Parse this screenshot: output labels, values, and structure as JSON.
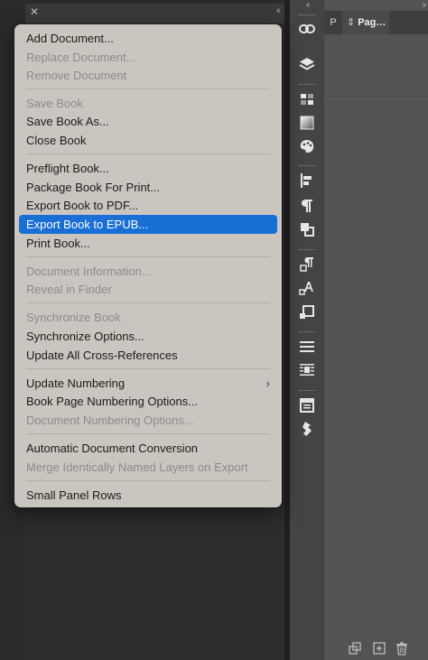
{
  "right_panel": {
    "tab_short": "P",
    "tab_pages": "Pag…"
  },
  "menu": {
    "items": [
      {
        "label": "Add Document...",
        "enabled": true
      },
      {
        "label": "Replace Document...",
        "enabled": false
      },
      {
        "label": "Remove Document",
        "enabled": false
      },
      {
        "label": "Save Book",
        "enabled": false
      },
      {
        "label": "Save Book As...",
        "enabled": true
      },
      {
        "label": "Close Book",
        "enabled": true
      },
      {
        "label": "Preflight Book...",
        "enabled": true
      },
      {
        "label": "Package Book For Print...",
        "enabled": true
      },
      {
        "label": "Export Book to PDF...",
        "enabled": true
      },
      {
        "label": "Export Book to EPUB...",
        "enabled": true,
        "highlighted": true
      },
      {
        "label": "Print Book...",
        "enabled": true
      },
      {
        "label": "Document Information...",
        "enabled": false
      },
      {
        "label": "Reveal in Finder",
        "enabled": false
      },
      {
        "label": "Synchronize Book",
        "enabled": false
      },
      {
        "label": "Synchronize Options...",
        "enabled": true
      },
      {
        "label": "Update All Cross-References",
        "enabled": true
      },
      {
        "label": "Update Numbering",
        "enabled": true,
        "submenu": true
      },
      {
        "label": "Book Page Numbering Options...",
        "enabled": true
      },
      {
        "label": "Document Numbering Options...",
        "enabled": false
      },
      {
        "label": "Automatic Document Conversion",
        "enabled": true
      },
      {
        "label": "Merge Identically Named Layers on Export",
        "enabled": false
      },
      {
        "label": "Small Panel Rows",
        "enabled": true
      }
    ]
  },
  "colors": {
    "menu_background": "#cbc5c0",
    "highlight": "#1a6fd6",
    "disabled_text": "#8e8a86"
  },
  "icons": {
    "book_panel": [
      "close-icon",
      "collapse-double-chevron-icon"
    ],
    "toolbar": [
      "links-icon",
      "layers-icon",
      "swatches-icon",
      "gradient-icon",
      "color-palette-icon",
      "align-icon",
      "paragraph-icon",
      "pathfinder-icon",
      "paragraph-styles-icon",
      "character-styles-icon",
      "object-styles-icon",
      "stroke-icon",
      "text-wrap-icon",
      "articles-icon",
      "glyphs-icon"
    ],
    "pages_panel_bottom": [
      "page-size-icon",
      "new-page-icon",
      "delete-page-icon"
    ]
  }
}
